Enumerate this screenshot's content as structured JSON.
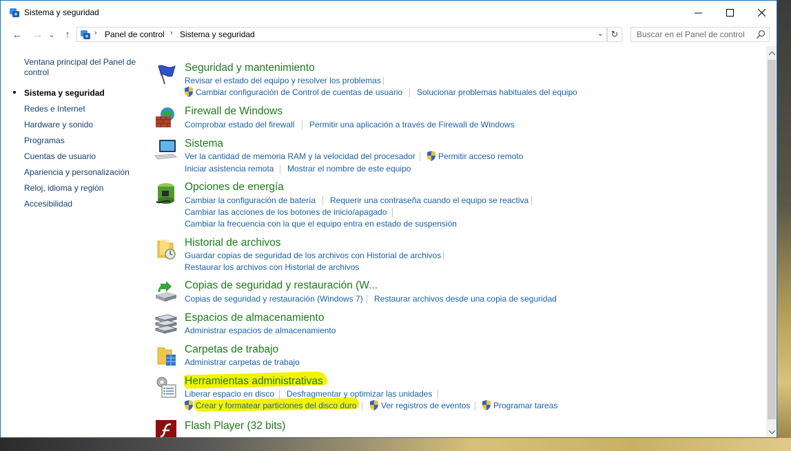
{
  "window": {
    "title": "Sistema y seguridad",
    "min_glyph": "—",
    "close_glyph": "✕"
  },
  "nav": {
    "back": "←",
    "forward": "→",
    "recent": "⌄",
    "up": "↑",
    "breadcrumb": [
      "Panel de control",
      "Sistema y seguridad"
    ],
    "breadcrumb_sep": "›",
    "dropdown": "⌄",
    "refresh": "↻"
  },
  "search": {
    "placeholder": "Buscar en el Panel de control"
  },
  "sidebar": {
    "items": [
      {
        "label": "Ventana principal del Panel de control"
      },
      {
        "label": "Sistema y seguridad",
        "active": true
      },
      {
        "label": "Redes e Internet"
      },
      {
        "label": "Hardware y sonido"
      },
      {
        "label": "Programas"
      },
      {
        "label": "Cuentas de usuario"
      },
      {
        "label": "Apariencia y personalización"
      },
      {
        "label": "Reloj, idioma y región"
      },
      {
        "label": "Accesibilidad"
      }
    ]
  },
  "categories": [
    {
      "title": "Seguridad y mantenimiento",
      "icon": "flag-icon",
      "links": [
        "Revisar el estado del equipo y resolver los problemas",
        "Cambiar configuración de Control de cuentas de usuario",
        "Solucionar problemas habituales del equipo"
      ]
    },
    {
      "title": "Firewall de Windows",
      "icon": "firewall-icon",
      "links": [
        "Comprobar estado del firewall",
        "Permitir una aplicación a través de Firewall de Windows"
      ]
    },
    {
      "title": "Sistema",
      "icon": "computer-icon",
      "links": [
        "Ver la cantidad de memoria RAM y la velocidad del procesador",
        "Permitir acceso remoto",
        "Iniciar asistencia remota",
        "Mostrar el nombre de este equipo"
      ]
    },
    {
      "title": "Opciones de energía",
      "icon": "battery-icon",
      "links": [
        "Cambiar la configuración de batería",
        "Requerir una contraseña cuando el equipo se reactiva",
        "Cambiar las acciones de los botones de inicio/apagado",
        "Cambiar la frecuencia con la que el equipo entra en estado de suspensión"
      ]
    },
    {
      "title": "Historial de archivos",
      "icon": "file-history-icon",
      "links": [
        "Guardar copias de seguridad de los archivos con Historial de archivos",
        "Restaurar los archivos con Historial de archivos"
      ]
    },
    {
      "title": "Copias de seguridad y restauración (W...",
      "icon": "backup-icon",
      "links": [
        "Copias de seguridad y restauración (Windows 7)",
        "Restaurar archivos desde una copia de seguridad"
      ]
    },
    {
      "title": "Espacios de almacenamiento",
      "icon": "storage-icon",
      "links": [
        "Administrar espacios de almacenamiento"
      ]
    },
    {
      "title": "Carpetas de trabajo",
      "icon": "work-folders-icon",
      "links": [
        "Administrar carpetas de trabajo"
      ]
    },
    {
      "title": "Herramientas administrativas",
      "icon": "admin-tools-icon",
      "links": [
        "Liberar espacio en disco",
        "Desfragmentar y optimizar las unidades",
        "Crear y formatear particiones del disco duro",
        "Ver registros de eventos",
        "Programar tareas"
      ]
    },
    {
      "title": "Flash Player (32 bits)",
      "icon": "flash-icon",
      "links": []
    }
  ],
  "colors": {
    "category_title": "#1e7b1e",
    "link": "#1b61a8",
    "highlight": "#f3f300",
    "window_border": "#1e6fc0"
  }
}
